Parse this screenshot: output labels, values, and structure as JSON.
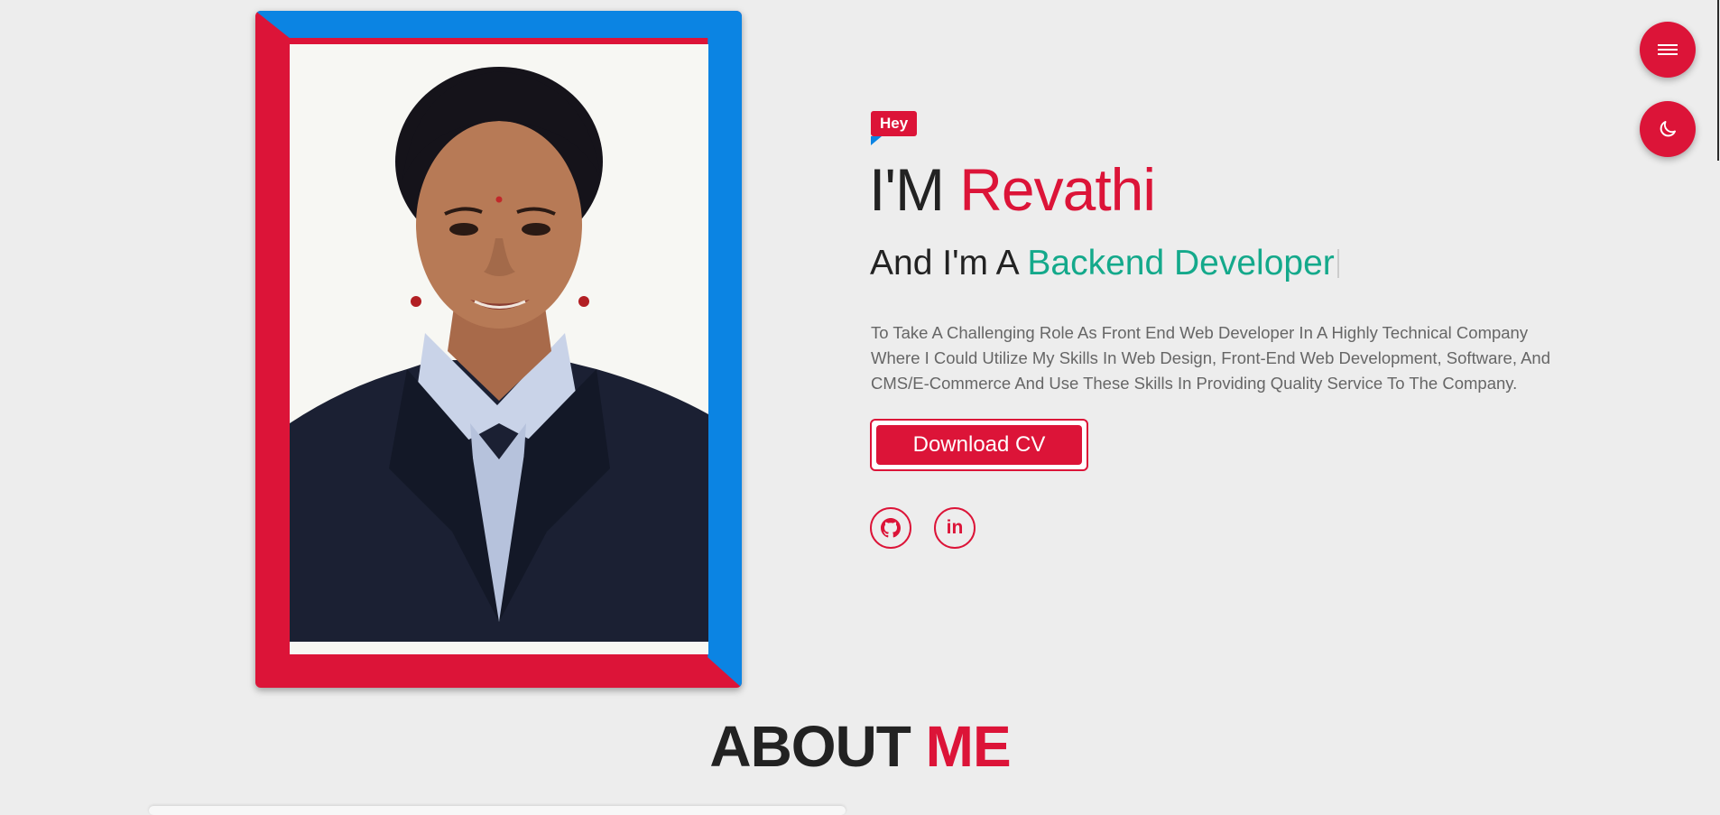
{
  "hero": {
    "badge": "Hey",
    "intro": "I'M",
    "name": "Revathi",
    "role_prefix": "And I'm A",
    "role": "Backend Developer",
    "description": "To Take A Challenging Role As Front End Web Developer In A Highly Technical Company Where I Could Utilize My Skills In Web Design, Front-End Web Development, Software, And CMS/E-Commerce And Use These Skills In Providing Quality Service To The Company.",
    "cv_button": "Download CV",
    "social": [
      {
        "icon": "github-icon"
      },
      {
        "icon": "linkedin-icon",
        "text": "in"
      }
    ]
  },
  "floating": {
    "menu_icon": "menu-icon",
    "theme_icon": "moon-icon"
  },
  "about": {
    "title_main": "ABOUT",
    "title_accent": "ME"
  },
  "colors": {
    "accent": "#dc1438",
    "blue": "#0b84e3",
    "teal": "#14a98b",
    "background": "#ededed"
  }
}
